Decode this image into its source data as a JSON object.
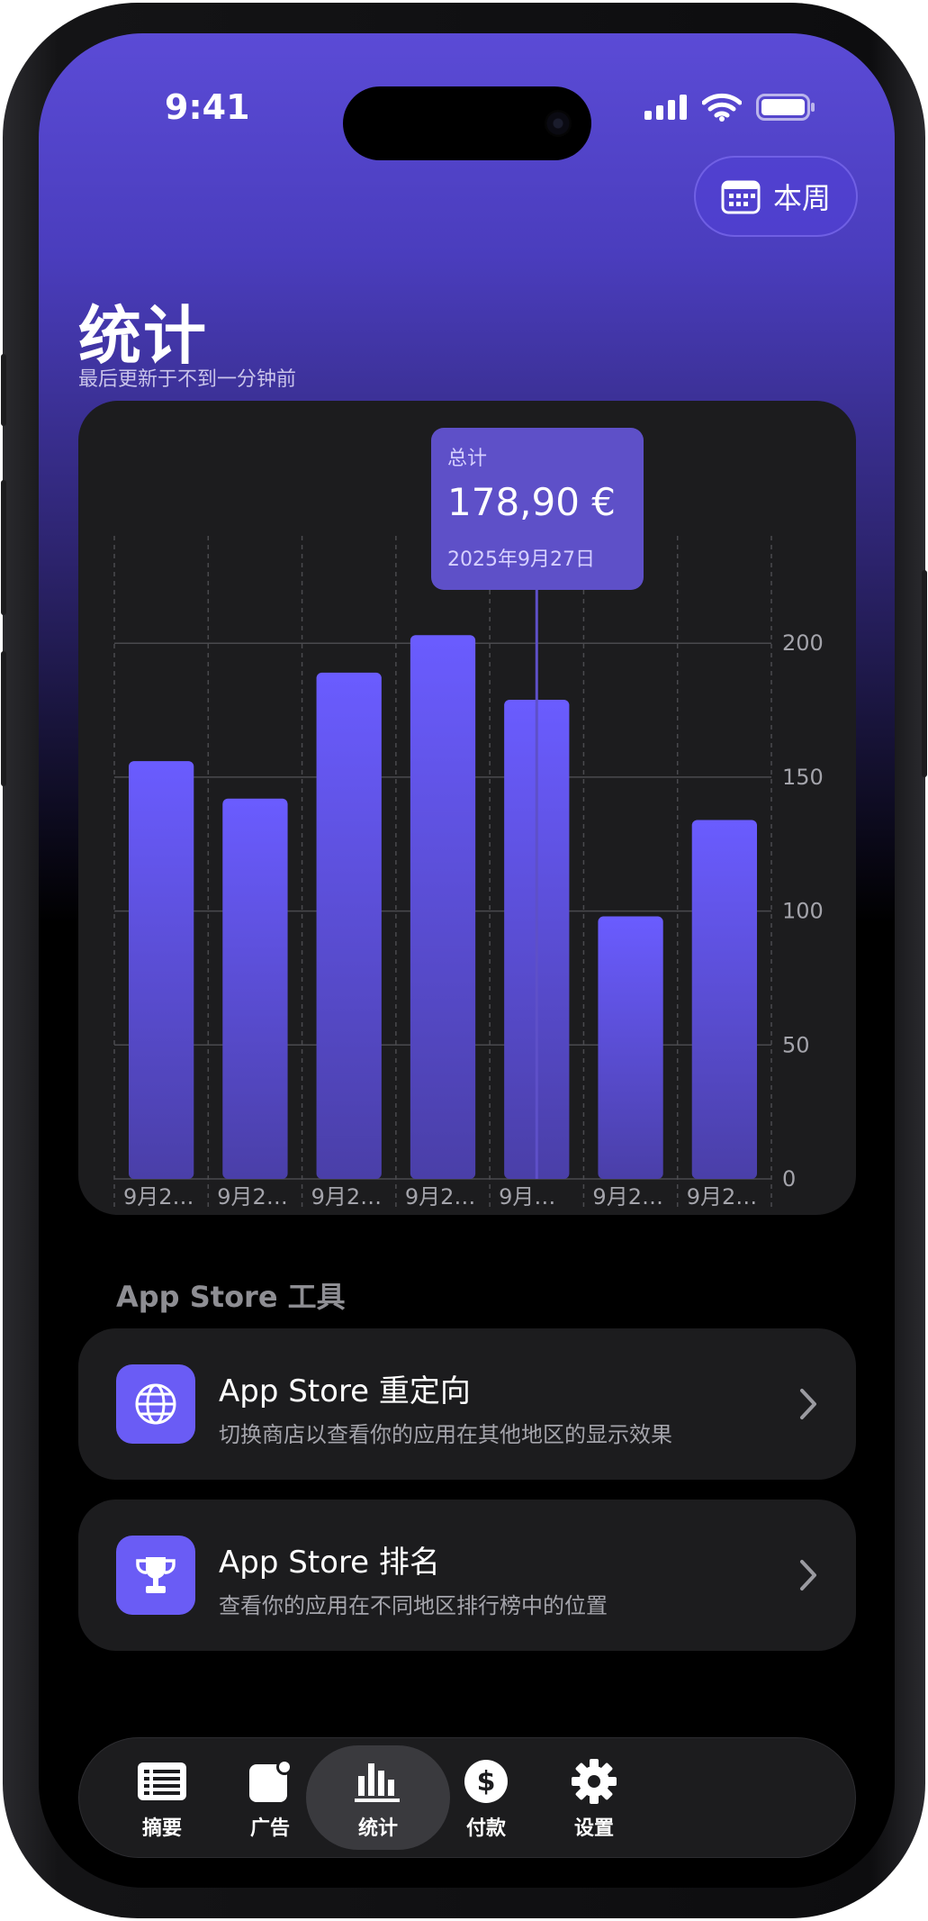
{
  "status_bar": {
    "time": "9:41"
  },
  "header": {
    "period_label": "本周",
    "title": "统计",
    "subtitle": "最后更新于不到一分钟前"
  },
  "tooltip": {
    "label": "总计",
    "value": "178,90 €",
    "date": "2025年9月27日"
  },
  "chart_data": {
    "type": "bar",
    "categories": [
      "9月2…",
      "9月2…",
      "9月2…",
      "9月2…",
      "9月…",
      "9月2…",
      "9月2…"
    ],
    "values": [
      156,
      142,
      189,
      203,
      178.9,
      98,
      134
    ],
    "ylim": [
      0,
      230
    ],
    "yticks": [
      0,
      50,
      100,
      150,
      200
    ],
    "selected_index": 4,
    "bar_color": "#6a5cff",
    "grid": true
  },
  "tools": {
    "section_title": "App Store 工具",
    "items": [
      {
        "title": "App Store 重定向",
        "subtitle": "切换商店以查看你的应用在其他地区的显示效果",
        "icon": "globe-icon"
      },
      {
        "title": "App Store 排名",
        "subtitle": "查看你的应用在不同地区排行榜中的位置",
        "icon": "trophy-icon"
      }
    ]
  },
  "tabbar": {
    "items": [
      {
        "label": "摘要",
        "icon": "list-icon"
      },
      {
        "label": "广告",
        "icon": "ad-icon"
      },
      {
        "label": "统计",
        "icon": "bar-chart-icon",
        "active": true
      },
      {
        "label": "付款",
        "icon": "dollar-icon"
      },
      {
        "label": "设置",
        "icon": "gear-icon"
      }
    ]
  }
}
